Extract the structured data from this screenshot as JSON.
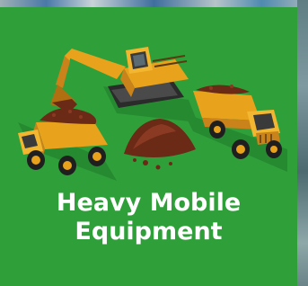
{
  "card": {
    "title_line1": "Heavy Mobile",
    "title_line2": "Equipment",
    "background_color": "#2f9f3a",
    "illustration": "excavator-and-dump-trucks-icon"
  }
}
